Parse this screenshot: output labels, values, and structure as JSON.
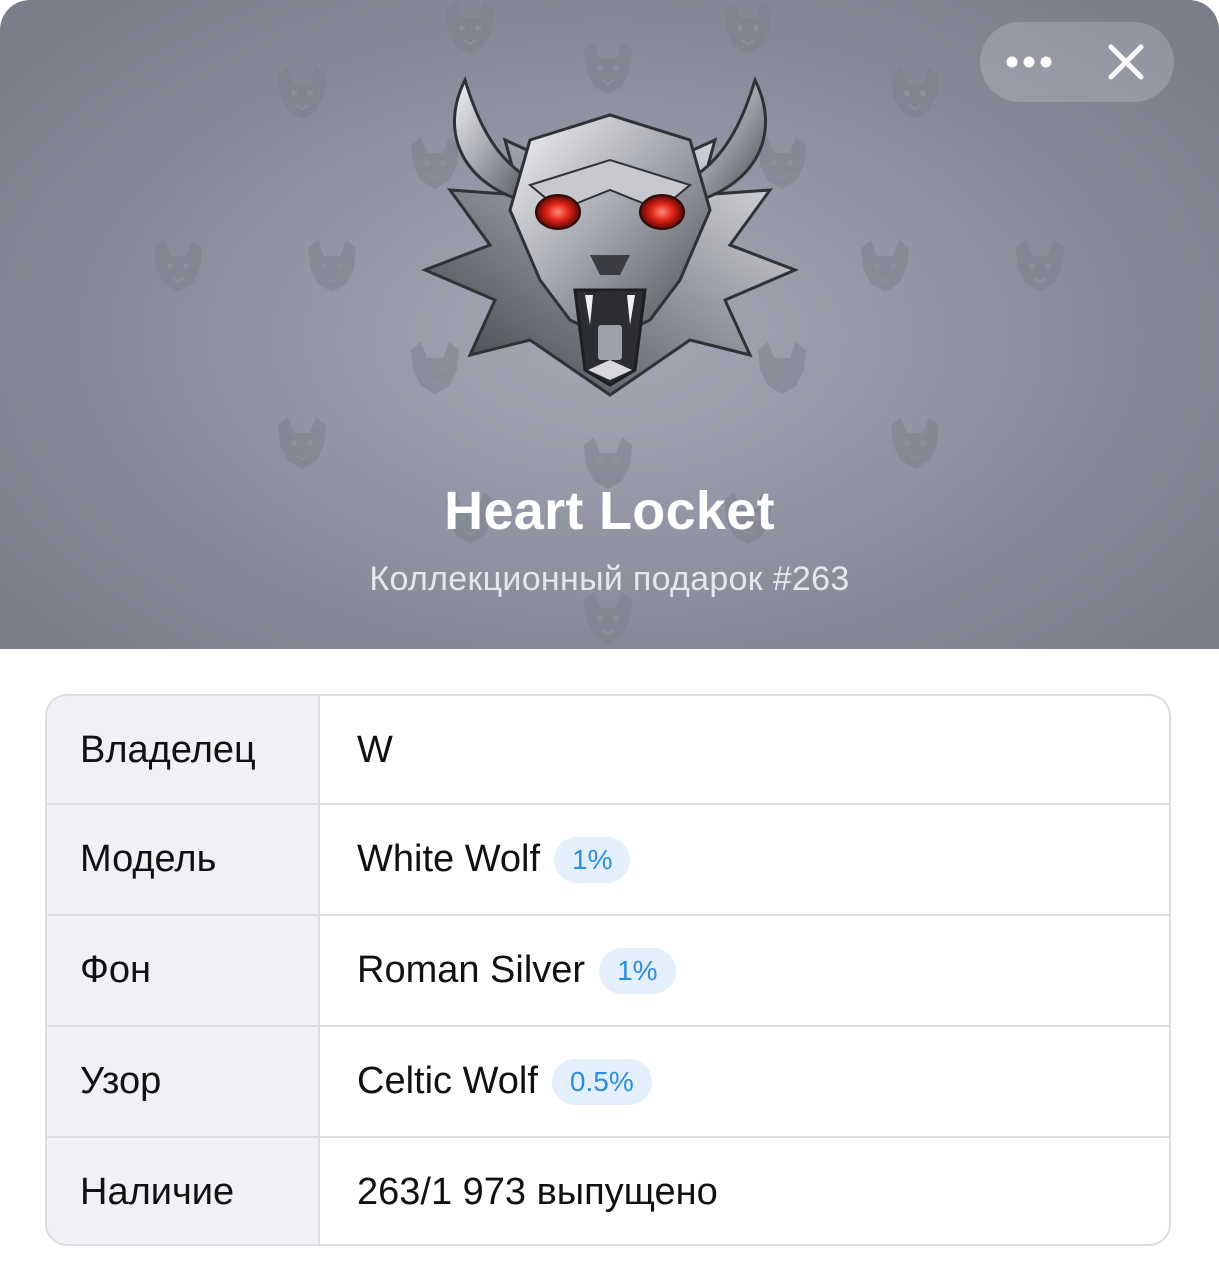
{
  "header": {
    "title": "Heart Locket",
    "subtitle": "Коллекционный подарок #263",
    "background_color": "#9497a5",
    "controls": [
      {
        "icon": "more-dots-icon"
      },
      {
        "icon": "close-icon"
      }
    ]
  },
  "emblem": {
    "icon": "wolf-head-emblem",
    "eye_color": "#e02418",
    "pattern_icon": "wolf-pattern-icon"
  },
  "details": {
    "rows": [
      {
        "label": "Владелец",
        "value": "W"
      },
      {
        "label": "Модель",
        "value": "White Wolf",
        "badge": "1%"
      },
      {
        "label": "Фон",
        "value": "Roman Silver",
        "badge": "1%"
      },
      {
        "label": "Узор",
        "value": "Celtic Wolf",
        "badge": "0.5%"
      },
      {
        "label": "Наличие",
        "value": "263/1 973 выпущено"
      }
    ],
    "badge_color": "#2f8de0"
  }
}
